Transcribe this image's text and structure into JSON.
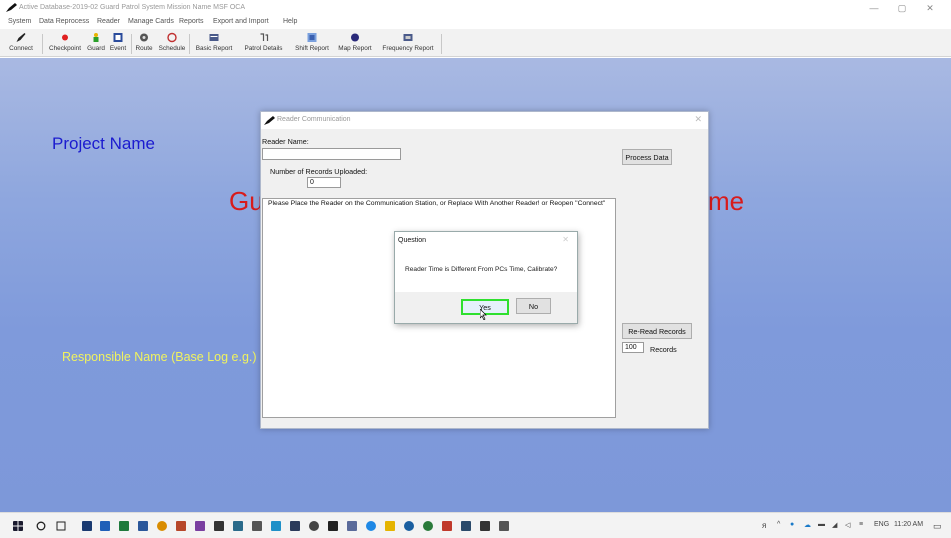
{
  "window": {
    "title": "Active Database-2019-02  Guard Patrol System Mission Name   MSF OCA"
  },
  "menu": [
    "System",
    "Data Reprocess",
    "Reader",
    "Manage Cards",
    "Reports",
    "Export and Import",
    "Help"
  ],
  "toolbar": [
    "Connect",
    "Checkpoint",
    "Guard",
    "Event",
    "Route",
    "Schedule",
    "Basic Report",
    "Patrol Details",
    "Shift Report",
    "Map Report",
    "Frequency Report"
  ],
  "workspace": {
    "project_name": "Project Name",
    "responsible_name": "Responsible Name (Base Log e.g.)",
    "big_title_left": "Gu",
    "big_title_right": "me"
  },
  "reader_dialog": {
    "title": "Reader Communication",
    "reader_name_label": "Reader Name:",
    "reader_name_value": "",
    "records_uploaded_label": "Number of Records Uploaded:",
    "records_uploaded_value": "0",
    "process_button": "Process Data",
    "message": "Please Place the Reader on the Communication Station, or Replace With Another Reader!    or Reopen \"Connect\"",
    "reread_button": "Re-Read Records",
    "records_count_value": "100",
    "records_label": "Records"
  },
  "question_dialog": {
    "title": "Question",
    "message": "Reader Time is Different From PCs Time, Calibrate?",
    "yes": "Yes",
    "no": "No"
  },
  "taskbar": {
    "tray_label": "ENG",
    "time": "11:20 AM"
  },
  "colors": {
    "project_name": "#1b1bcf",
    "responsible_name": "#f1f35e",
    "big_title": "#d81b1b",
    "focus_highlight": "#2fe02f"
  }
}
